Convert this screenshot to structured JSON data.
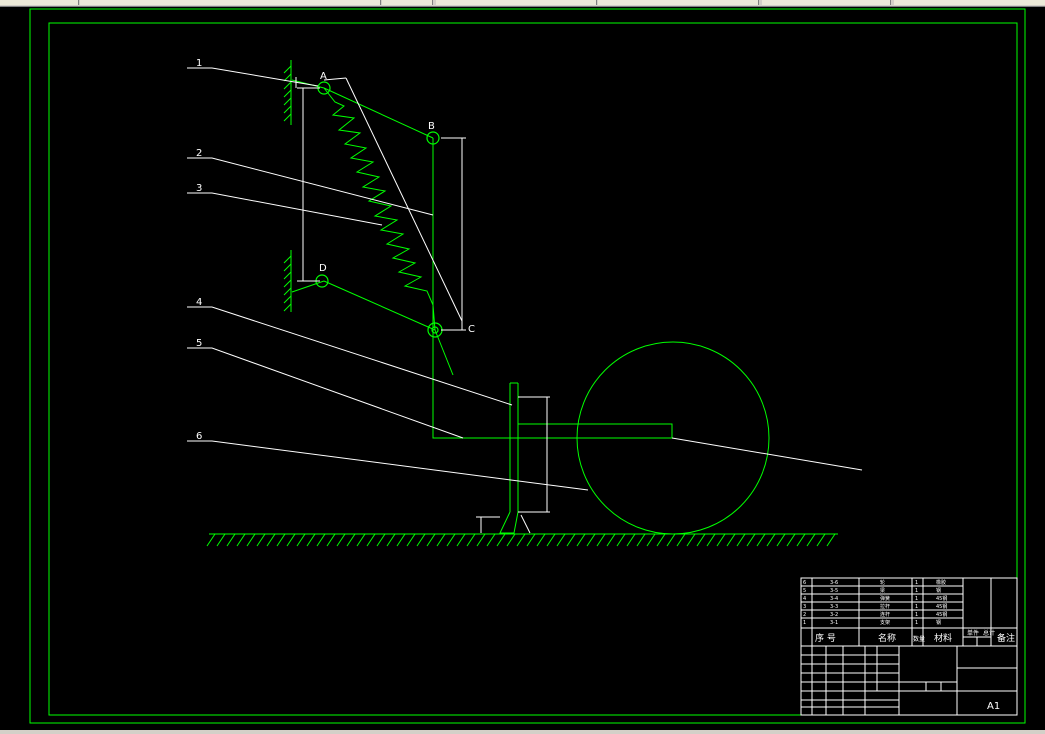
{
  "part_numbers": [
    "1",
    "2",
    "3",
    "4",
    "5",
    "6"
  ],
  "joints": {
    "a": "A",
    "b": "B",
    "c": "C",
    "d": "D"
  },
  "colors": {
    "geometry": "#00ff00",
    "annotation": "#ffffff",
    "background": "#000000"
  },
  "title_block": {
    "sheet_size": "A1",
    "header_labels": [
      "序 号",
      "名称",
      "数量",
      "材料",
      "单件",
      "总计",
      "备注"
    ],
    "bom_rows": [
      {
        "no": "6",
        "code": "3-6",
        "name": "轮",
        "qty": "1",
        "mat": "橡胶"
      },
      {
        "no": "5",
        "code": "3-5",
        "name": "梁",
        "qty": "1",
        "mat": "钢"
      },
      {
        "no": "4",
        "code": "3-4",
        "name": "弹簧",
        "qty": "1",
        "mat": "45钢"
      },
      {
        "no": "3",
        "code": "3-3",
        "name": "拉杆",
        "qty": "1",
        "mat": "45钢"
      },
      {
        "no": "2",
        "code": "3-2",
        "name": "连杆",
        "qty": "1",
        "mat": "45钢"
      },
      {
        "no": "1",
        "code": "3-1",
        "name": "支架",
        "qty": "1",
        "mat": "钢"
      }
    ]
  }
}
